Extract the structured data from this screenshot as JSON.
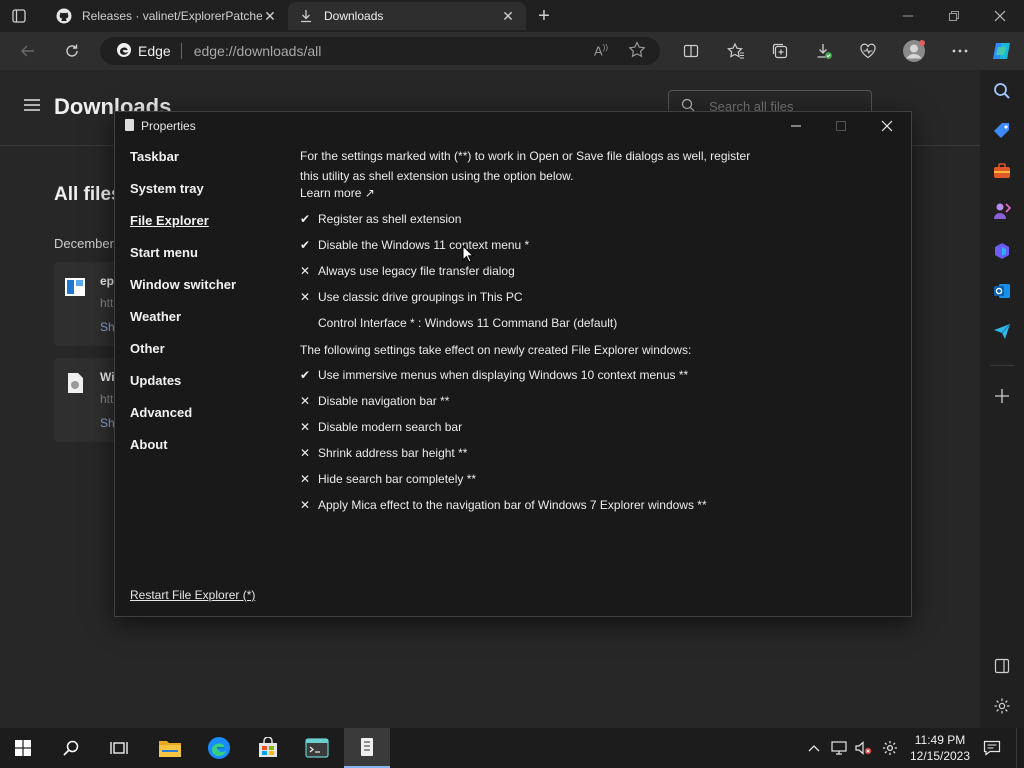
{
  "browser": {
    "tabs": [
      {
        "label": "Releases · valinet/ExplorerPatche",
        "icon": "github-icon",
        "active": false
      },
      {
        "label": "Downloads",
        "icon": "download-icon",
        "active": true
      }
    ],
    "address": {
      "brand": "Edge",
      "url": "edge://downloads/all"
    }
  },
  "downloads_page": {
    "title": "Downloads",
    "search_placeholder": "Search all files",
    "section_title": "All files",
    "group_label": "December",
    "items": [
      {
        "name": "ep",
        "url": "htt",
        "action": "Sh"
      },
      {
        "name": "Wi",
        "url": "htt",
        "action": "Sh"
      }
    ]
  },
  "dialog": {
    "title": "Properties",
    "nav": [
      {
        "label": "Taskbar",
        "active": false
      },
      {
        "label": "System tray",
        "active": false
      },
      {
        "label": "File Explorer",
        "active": true
      },
      {
        "label": "Start menu",
        "active": false
      },
      {
        "label": "Window switcher",
        "active": false
      },
      {
        "label": "Weather",
        "active": false
      },
      {
        "label": "Other",
        "active": false
      },
      {
        "label": "Updates",
        "active": false
      },
      {
        "label": "Advanced",
        "active": false
      },
      {
        "label": "About",
        "active": false
      }
    ],
    "intro": "For the settings marked with (**) to work in Open or Save file dialogs as well, register this utility as shell extension using the option below.",
    "learn_more": "Learn more ↗",
    "options_group1": [
      {
        "mark": "✔",
        "label": "Register as shell extension"
      },
      {
        "mark": "✔",
        "label": "Disable the Windows 11 context menu *"
      },
      {
        "mark": "✕",
        "label": "Always use legacy file transfer dialog"
      },
      {
        "mark": "✕",
        "label": "Use classic drive groupings in This PC"
      },
      {
        "mark": "",
        "label": "Control Interface * : Windows 11 Command Bar (default)"
      }
    ],
    "subheading": "The following settings take effect on newly created File Explorer windows:",
    "options_group2": [
      {
        "mark": "✔",
        "label": "Use immersive menus when displaying Windows 10 context menus **"
      },
      {
        "mark": "✕",
        "label": "Disable navigation bar **"
      },
      {
        "mark": "✕",
        "label": "Disable modern search bar"
      },
      {
        "mark": "✕",
        "label": "Shrink address bar height **"
      },
      {
        "mark": "✕",
        "label": "Hide search bar completely **"
      },
      {
        "mark": "✕",
        "label": "Apply Mica effect to the navigation bar of Windows 7 Explorer windows **"
      }
    ],
    "restart_link": "Restart File Explorer (*)"
  },
  "taskbar": {
    "time": "11:49 PM",
    "date": "12/15/2023"
  },
  "colors": {
    "edge_blue": "#1a8cff",
    "taskbar_accent": "#8ab4f8"
  }
}
